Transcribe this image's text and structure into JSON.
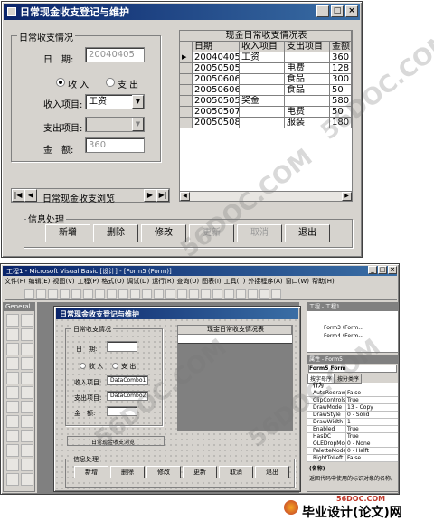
{
  "top": {
    "title": "日常现金收支登记与维护",
    "group_daily": "日常收支情况",
    "date_label": "日　期:",
    "date_value": "20040405",
    "income_radio": "收 入",
    "expense_radio": "支 出",
    "income_item_label": "收入项目:",
    "income_item_value": "工资",
    "expense_item_label": "支出项目:",
    "amount_label": "金　额:",
    "amount_value": "360",
    "grid_title": "现金日常收支情况表",
    "columns": [
      "日期",
      "收入项目",
      "支出项目",
      "金额"
    ],
    "rows": [
      [
        "20040405",
        "工资",
        "",
        "360"
      ],
      [
        "20050505",
        "",
        "电费",
        "128"
      ],
      [
        "20050606",
        "",
        "食品",
        "300"
      ],
      [
        "20050606",
        "",
        "食品",
        "50"
      ],
      [
        "20050505",
        "奖金",
        "",
        "580"
      ],
      [
        "20050507",
        "",
        "电费",
        "50"
      ],
      [
        "20050508",
        "",
        "服装",
        "180"
      ]
    ],
    "nav_label": "日常现金收支浏览",
    "ops_group": "信息处理",
    "buttons": [
      "新增",
      "删除",
      "修改",
      "更新",
      "取消",
      "退出"
    ]
  },
  "ide": {
    "title": "工程1 - Microsoft Visual Basic [设计] - [Form5 (Form)]",
    "menus": [
      "文件(F)",
      "编辑(E)",
      "视图(V)",
      "工程(P)",
      "格式(O)",
      "调试(D)",
      "运行(R)",
      "查询(U)",
      "图表(I)",
      "工具(T)",
      "外接程序(A)",
      "窗口(W)",
      "帮助(H)"
    ],
    "toolbox_title": "General",
    "form_title": "日常现金收支登记与维护",
    "group_daily": "日常收支情况",
    "date_label": "日　期:",
    "income_radio": "收 入",
    "expense_radio": "支 出",
    "income_item_label": "收入项目:",
    "combo1": "DataCombo1",
    "expense_item_label": "支出项目:",
    "combo2": "DataCombo2",
    "amount_label": "金　额:",
    "grid_title": "现金日常收支情况表",
    "nav_label": "日常现金收支浏览",
    "ops_group": "信息处理",
    "buttons": [
      "新增",
      "删除",
      "修改",
      "更新",
      "取消",
      "退出"
    ],
    "project_title": "工程 - 工程1",
    "project_items": [
      "Form3 (Form...",
      "Form4 (Form..."
    ],
    "props_title": "属性 - Form5",
    "props_object": "Form5 Form",
    "props_tabs": [
      "按字母序",
      "按分类序"
    ],
    "props_category": "行为",
    "props": [
      [
        "AutoRedraw",
        "False"
      ],
      [
        "ClipControls",
        "True"
      ],
      [
        "DrawMode",
        "13 - Copy"
      ],
      [
        "DrawStyle",
        "0 - Solid"
      ],
      [
        "DrawWidth",
        "1"
      ],
      [
        "Enabled",
        "True"
      ],
      [
        "HasDC",
        "True"
      ],
      [
        "OLEDropMode",
        "0 - None"
      ],
      [
        "PaletteMode",
        "0 - Halft"
      ],
      [
        "RightToLeft",
        "False"
      ]
    ],
    "desc_title": "(名称)",
    "desc_text": "返回代码中使用的标识对象的名称。"
  },
  "watermark": "56DOC.COM",
  "footer_url": "56DOC.COM",
  "footer_brand": "毕业设计(论文)网"
}
